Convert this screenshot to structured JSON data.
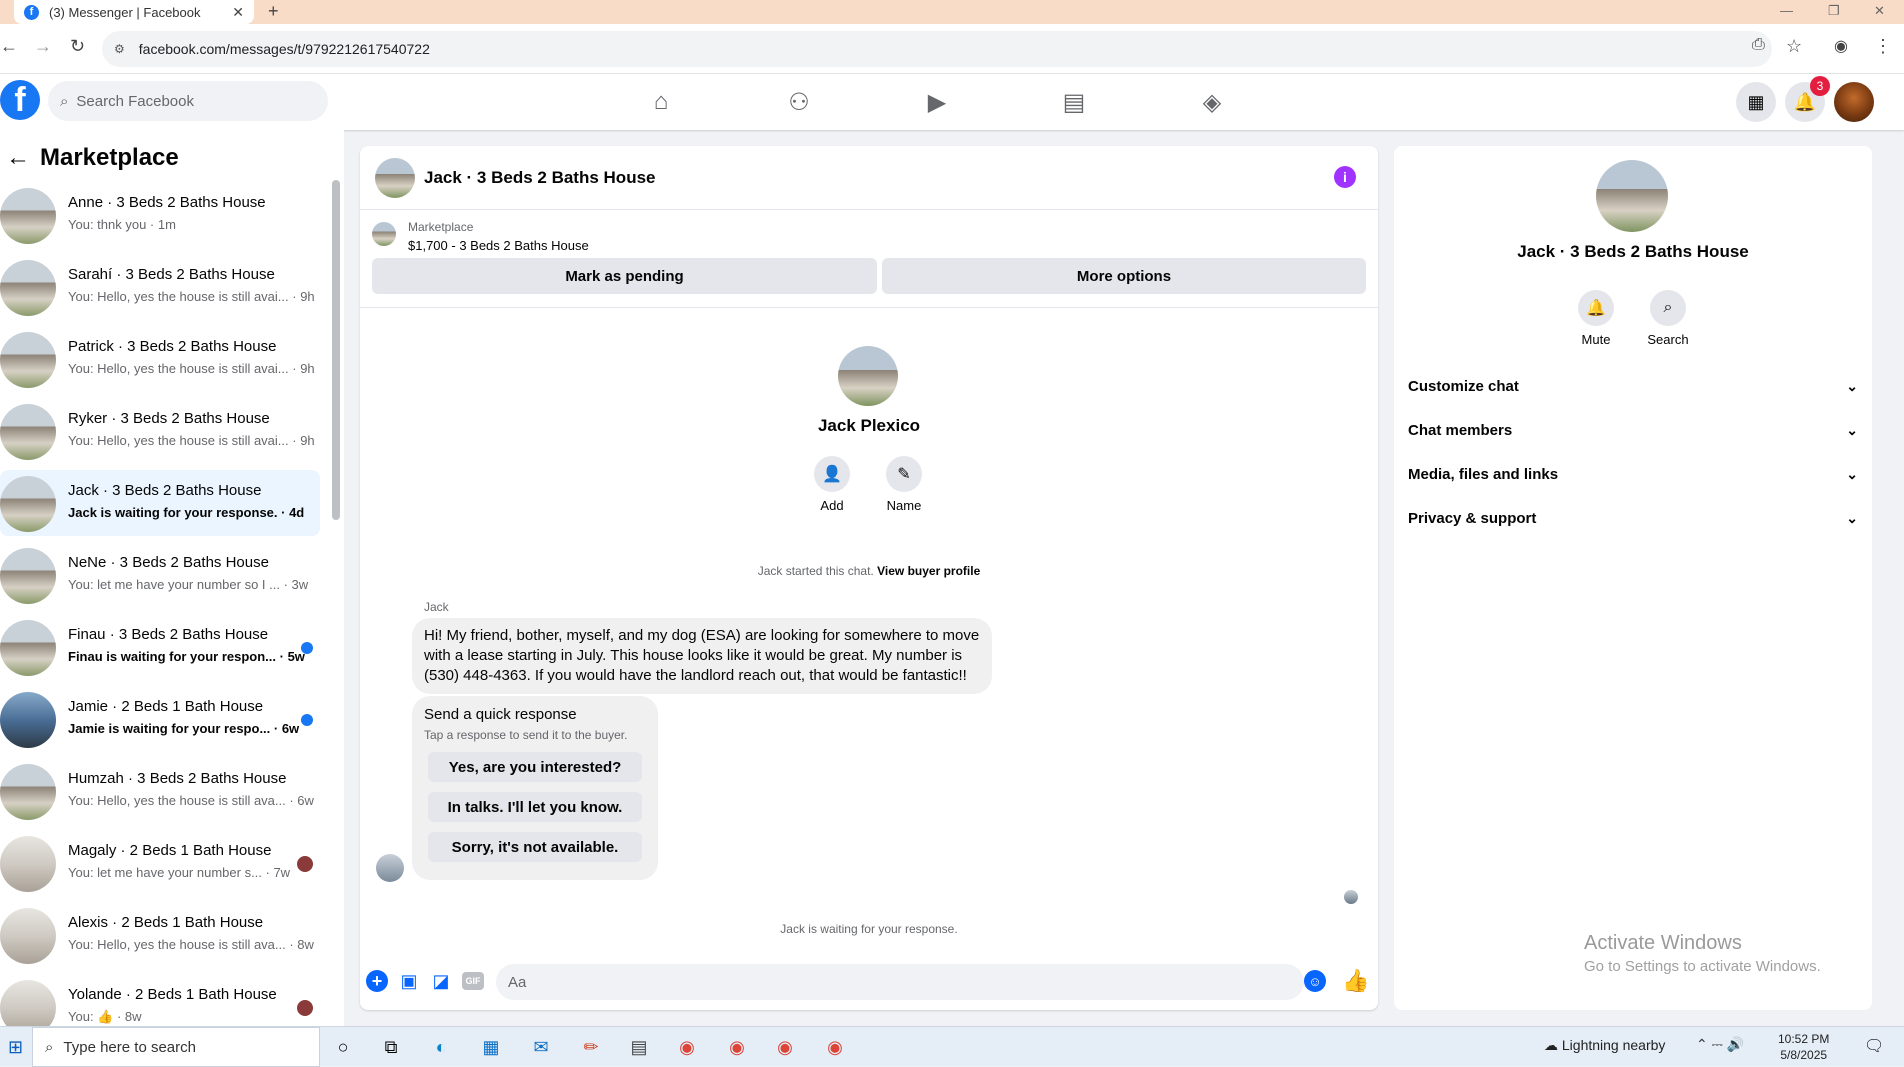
{
  "browser": {
    "tab_title": "(3) Messenger | Facebook",
    "tab_icon": "f",
    "url": "facebook.com/messages/t/9792212617540722"
  },
  "header": {
    "search_placeholder": "Search Facebook",
    "notification_count": "3",
    "brand_color": "#1877f2"
  },
  "sidebar": {
    "title": "Marketplace",
    "conversations": [
      {
        "name": "Anne · 3 Beds 2 Baths House",
        "snippet": "You: thnk you · 1m",
        "unread": false
      },
      {
        "name": "Sarahí · 3 Beds 2 Baths House",
        "snippet": "You: Hello, yes the house is still avai... · 9h",
        "unread": false
      },
      {
        "name": "Patrick · 3 Beds 2 Baths House",
        "snippet": "You: Hello, yes the house is still avai... · 9h",
        "unread": false
      },
      {
        "name": "Ryker · 3 Beds 2 Baths House",
        "snippet": "You: Hello, yes the house is still avai... · 9h",
        "unread": false
      },
      {
        "name": "Jack · 3 Beds 2 Baths House",
        "snippet": "Jack is waiting for your response. · 4d",
        "unread": false,
        "active": true
      },
      {
        "name": "NeNe · 3 Beds 2 Baths House",
        "snippet": "You: let me have your number so I ... · 3w",
        "unread": false
      },
      {
        "name": "Finau · 3 Beds 2 Baths House",
        "snippet": "Finau is waiting for your respon... · 5w",
        "unread": true
      },
      {
        "name": "Jamie · 2 Beds 1 Bath House",
        "snippet": "Jamie is waiting for your respo... · 6w",
        "unread": true
      },
      {
        "name": "Humzah · 3 Beds 2 Baths House",
        "snippet": "You: Hello, yes the house is still ava... · 6w",
        "unread": false
      },
      {
        "name": "Magaly · 2 Beds 1 Bath House",
        "snippet": "You: let me have your number s... · 7w",
        "unread": false
      },
      {
        "name": "Alexis · 2 Beds 1 Bath House",
        "snippet": "You: Hello, yes the house is still ava... · 8w",
        "unread": false
      },
      {
        "name": "Yolande · 2 Beds 1 Bath House",
        "snippet": "You: 👍 · 8w",
        "unread": false
      }
    ]
  },
  "chat": {
    "title": "Jack · 3 Beds 2 Baths House",
    "marketplace_label": "Marketplace",
    "listing": "$1,700 - 3 Beds 2 Baths House",
    "mark_pending": "Mark as pending",
    "more_options": "More options",
    "profile_name": "Jack Plexico",
    "add_label": "Add",
    "name_label": "Name",
    "started_text": "Jack started this chat.",
    "view_buyer": "View buyer profile",
    "sender": "Jack",
    "message": "Hi! My friend, bother, myself, and my dog (ESA) are looking for somewhere to move with a lease starting in July. This house looks like it would be great. My number is (530) 448-4363. If you would have the landlord reach out, that would be fantastic!!",
    "quick_title": "Send a quick response",
    "quick_sub": "Tap a response to send it to the buyer.",
    "quick_replies": [
      "Yes, are you interested?",
      "In talks. I'll let you know.",
      "Sorry, it's not available."
    ],
    "waiting": "Jack is waiting for your response.",
    "input_placeholder": "Aa",
    "gif_label": "GIF"
  },
  "details": {
    "name": "Jack · 3 Beds 2 Baths House",
    "mute": "Mute",
    "search": "Search",
    "sections": [
      "Customize chat",
      "Chat members",
      "Media, files and links",
      "Privacy & support"
    ]
  },
  "watermark": {
    "line1": "Activate Windows",
    "line2": "Go to Settings to activate Windows."
  },
  "taskbar": {
    "search_placeholder": "Type here to search",
    "weather": "Lightning nearby",
    "time": "10:52 PM",
    "date": "5/8/2025"
  }
}
